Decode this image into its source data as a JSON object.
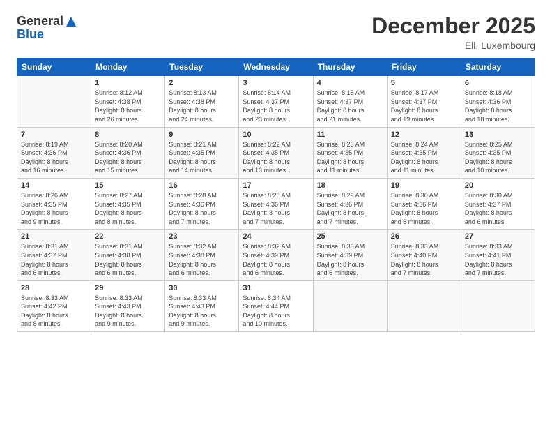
{
  "logo": {
    "general": "General",
    "blue": "Blue"
  },
  "header": {
    "month": "December 2025",
    "location": "Ell, Luxembourg"
  },
  "weekdays": [
    "Sunday",
    "Monday",
    "Tuesday",
    "Wednesday",
    "Thursday",
    "Friday",
    "Saturday"
  ],
  "weeks": [
    [
      {
        "day": "",
        "info": ""
      },
      {
        "day": "1",
        "info": "Sunrise: 8:12 AM\nSunset: 4:38 PM\nDaylight: 8 hours\nand 26 minutes."
      },
      {
        "day": "2",
        "info": "Sunrise: 8:13 AM\nSunset: 4:38 PM\nDaylight: 8 hours\nand 24 minutes."
      },
      {
        "day": "3",
        "info": "Sunrise: 8:14 AM\nSunset: 4:37 PM\nDaylight: 8 hours\nand 23 minutes."
      },
      {
        "day": "4",
        "info": "Sunrise: 8:15 AM\nSunset: 4:37 PM\nDaylight: 8 hours\nand 21 minutes."
      },
      {
        "day": "5",
        "info": "Sunrise: 8:17 AM\nSunset: 4:37 PM\nDaylight: 8 hours\nand 19 minutes."
      },
      {
        "day": "6",
        "info": "Sunrise: 8:18 AM\nSunset: 4:36 PM\nDaylight: 8 hours\nand 18 minutes."
      }
    ],
    [
      {
        "day": "7",
        "info": "Sunrise: 8:19 AM\nSunset: 4:36 PM\nDaylight: 8 hours\nand 16 minutes."
      },
      {
        "day": "8",
        "info": "Sunrise: 8:20 AM\nSunset: 4:36 PM\nDaylight: 8 hours\nand 15 minutes."
      },
      {
        "day": "9",
        "info": "Sunrise: 8:21 AM\nSunset: 4:35 PM\nDaylight: 8 hours\nand 14 minutes."
      },
      {
        "day": "10",
        "info": "Sunrise: 8:22 AM\nSunset: 4:35 PM\nDaylight: 8 hours\nand 13 minutes."
      },
      {
        "day": "11",
        "info": "Sunrise: 8:23 AM\nSunset: 4:35 PM\nDaylight: 8 hours\nand 11 minutes."
      },
      {
        "day": "12",
        "info": "Sunrise: 8:24 AM\nSunset: 4:35 PM\nDaylight: 8 hours\nand 11 minutes."
      },
      {
        "day": "13",
        "info": "Sunrise: 8:25 AM\nSunset: 4:35 PM\nDaylight: 8 hours\nand 10 minutes."
      }
    ],
    [
      {
        "day": "14",
        "info": "Sunrise: 8:26 AM\nSunset: 4:35 PM\nDaylight: 8 hours\nand 9 minutes."
      },
      {
        "day": "15",
        "info": "Sunrise: 8:27 AM\nSunset: 4:35 PM\nDaylight: 8 hours\nand 8 minutes."
      },
      {
        "day": "16",
        "info": "Sunrise: 8:28 AM\nSunset: 4:36 PM\nDaylight: 8 hours\nand 7 minutes."
      },
      {
        "day": "17",
        "info": "Sunrise: 8:28 AM\nSunset: 4:36 PM\nDaylight: 8 hours\nand 7 minutes."
      },
      {
        "day": "18",
        "info": "Sunrise: 8:29 AM\nSunset: 4:36 PM\nDaylight: 8 hours\nand 7 minutes."
      },
      {
        "day": "19",
        "info": "Sunrise: 8:30 AM\nSunset: 4:36 PM\nDaylight: 8 hours\nand 6 minutes."
      },
      {
        "day": "20",
        "info": "Sunrise: 8:30 AM\nSunset: 4:37 PM\nDaylight: 8 hours\nand 6 minutes."
      }
    ],
    [
      {
        "day": "21",
        "info": "Sunrise: 8:31 AM\nSunset: 4:37 PM\nDaylight: 8 hours\nand 6 minutes."
      },
      {
        "day": "22",
        "info": "Sunrise: 8:31 AM\nSunset: 4:38 PM\nDaylight: 8 hours\nand 6 minutes."
      },
      {
        "day": "23",
        "info": "Sunrise: 8:32 AM\nSunset: 4:38 PM\nDaylight: 8 hours\nand 6 minutes."
      },
      {
        "day": "24",
        "info": "Sunrise: 8:32 AM\nSunset: 4:39 PM\nDaylight: 8 hours\nand 6 minutes."
      },
      {
        "day": "25",
        "info": "Sunrise: 8:33 AM\nSunset: 4:39 PM\nDaylight: 8 hours\nand 6 minutes."
      },
      {
        "day": "26",
        "info": "Sunrise: 8:33 AM\nSunset: 4:40 PM\nDaylight: 8 hours\nand 7 minutes."
      },
      {
        "day": "27",
        "info": "Sunrise: 8:33 AM\nSunset: 4:41 PM\nDaylight: 8 hours\nand 7 minutes."
      }
    ],
    [
      {
        "day": "28",
        "info": "Sunrise: 8:33 AM\nSunset: 4:42 PM\nDaylight: 8 hours\nand 8 minutes."
      },
      {
        "day": "29",
        "info": "Sunrise: 8:33 AM\nSunset: 4:43 PM\nDaylight: 8 hours\nand 9 minutes."
      },
      {
        "day": "30",
        "info": "Sunrise: 8:33 AM\nSunset: 4:43 PM\nDaylight: 8 hours\nand 9 minutes."
      },
      {
        "day": "31",
        "info": "Sunrise: 8:34 AM\nSunset: 4:44 PM\nDaylight: 8 hours\nand 10 minutes."
      },
      {
        "day": "",
        "info": ""
      },
      {
        "day": "",
        "info": ""
      },
      {
        "day": "",
        "info": ""
      }
    ]
  ]
}
